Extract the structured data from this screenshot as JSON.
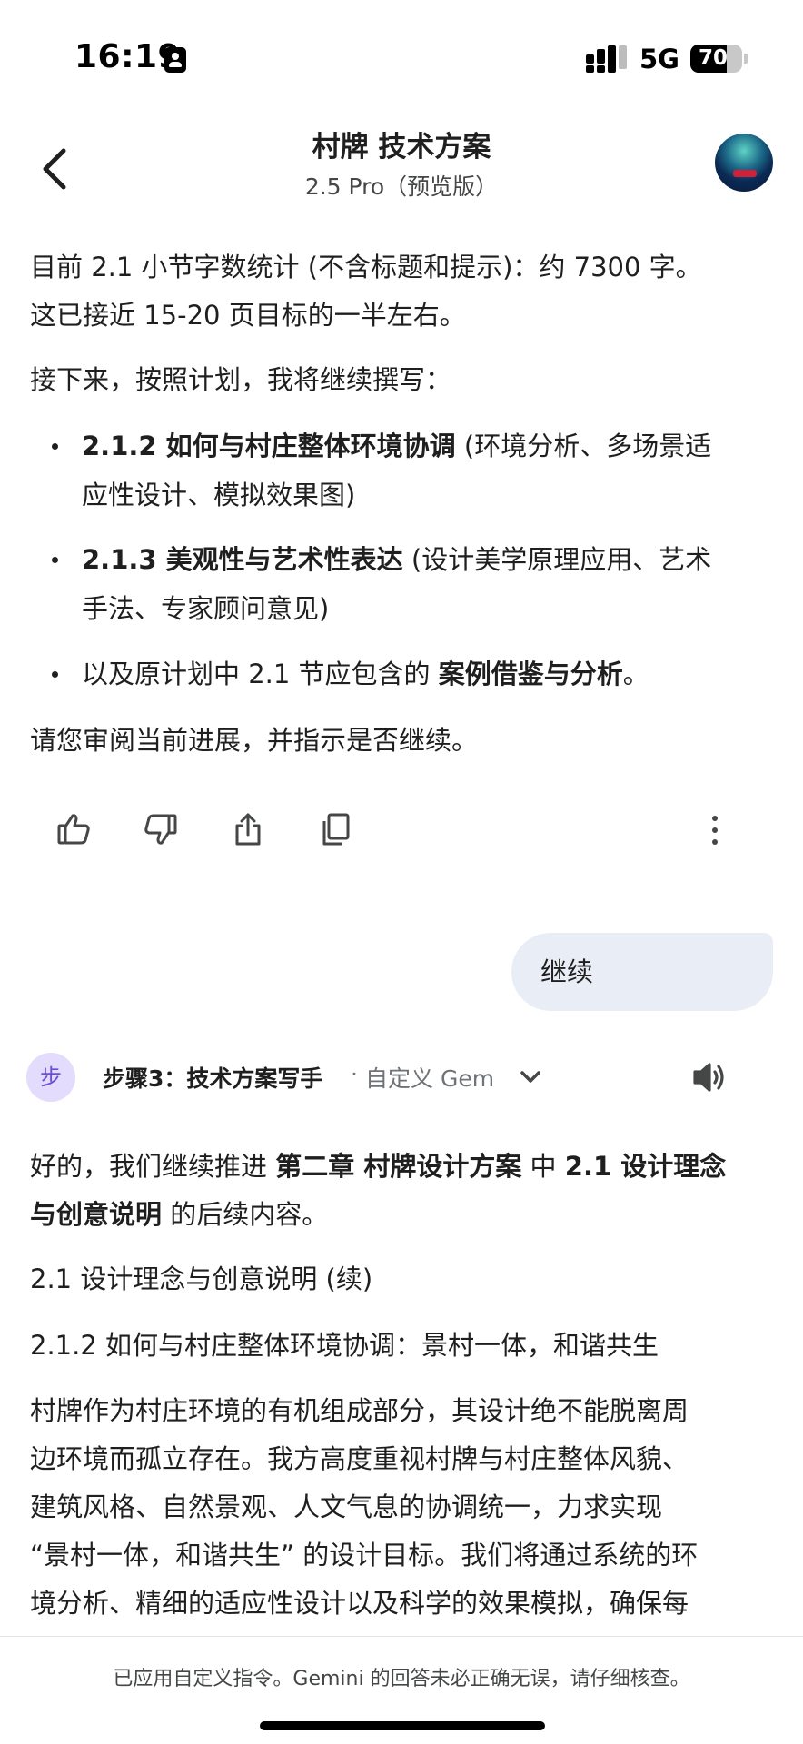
{
  "status_bar": {
    "time": "16:19",
    "network": "5G",
    "battery": "70",
    "battery_level": 0.7
  },
  "header": {
    "title": "村牌 技术方案",
    "model": "2.5 Pro（预览版）"
  },
  "response1": {
    "stats_line1": "目前 2.1 小节字数统计 (不含标题和提示)：约 7300 字。",
    "stats_line2": "这已接近 15-20 页目标的一半左右。",
    "next_intro": "接下来，按照计划，我将继续撰写：",
    "bullets": [
      {
        "bold": "2.1.2 如何与村庄整体环境协调",
        "line1_rest": " (环境分析、多场景适",
        "line2": "应性设计、模拟效果图)"
      },
      {
        "bold": "2.1.3 美观性与艺术性表达",
        "line1_rest": " (设计美学原理应用、艺术",
        "line2": "手法、专家顾问意见)"
      },
      {
        "prefix": "以及原计划中 2.1 节应包含的 ",
        "bold": "案例借鉴与分析",
        "suffix": "。"
      }
    ],
    "closing": "请您审阅当前进展，并指示是否继续。"
  },
  "actions": {
    "icons": [
      "thumbs-up-icon",
      "thumbs-down-icon",
      "share-icon",
      "copy-icon",
      "more-vert-icon"
    ]
  },
  "user_message": {
    "text": "继续"
  },
  "gem": {
    "badge": "步",
    "name": "步骤3：技术方案写手",
    "separator": "·",
    "type": "自定义 Gem"
  },
  "response2": {
    "intro_l1_a": "好的，我们继续推进 ",
    "intro_l1_b": "第二章 村牌设计方案",
    "intro_l1_c": " 中 ",
    "intro_l1_d": "2.1 设计理念",
    "intro_l2_a": "与创意说明",
    "intro_l2_b": " 的后续内容。",
    "heading1": "2.1 设计理念与创意说明 (续)",
    "heading2": "2.1.2 如何与村庄整体环境协调：景村一体，和谐共生",
    "body_lines": [
      "村牌作为村庄环境的有机组成部分，其设计绝不能脱离周",
      "边环境而孤立存在。我方高度重视村牌与村庄整体风貌、",
      "建筑风格、自然景观、人文气息的协调统一，力求实现",
      "“景村一体，和谐共生” 的设计目标。我们将通过系统的环",
      "境分析、精细的适应性设计以及科学的效果模拟，确保每"
    ]
  },
  "footer": {
    "disclaimer": "已应用自定义指令。Gemini 的回答未必正确无误，请仔细核查。"
  }
}
